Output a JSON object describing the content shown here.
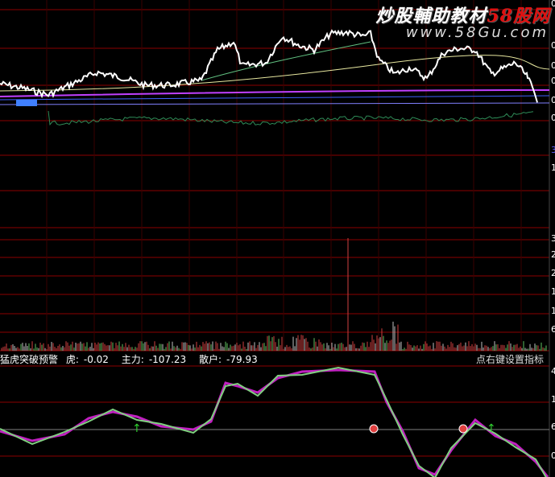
{
  "watermark": {
    "brand_white": "炒股輔助教材",
    "brand_red": "58股网",
    "url": "www.58Gu.com"
  },
  "indicator": {
    "name": "猛虎突破预警",
    "tiger_label": "虎:",
    "tiger_value": "-0.02",
    "main_label": "主力:",
    "main_value": "-107.23",
    "retail_label": "散户:",
    "retail_value": "-79.93",
    "hint": "点右键设置指标"
  },
  "axis_digits": [
    "0",
    "0",
    "0",
    "0",
    "0",
    "0",
    "3",
    "1",
    "3",
    "2",
    "2",
    "1",
    "1",
    "6",
    "4",
    "1",
    "6",
    "0"
  ],
  "colors": {
    "price": "#ffffff",
    "avg": "#2e8b57",
    "ma_yellow": "#e8e8a0",
    "ma_purple": "#c040ff",
    "ma_blue": "#4060ff",
    "main_line": "#c020c0",
    "retail_line": "#80d080",
    "grid_red": "#8b0000"
  }
}
